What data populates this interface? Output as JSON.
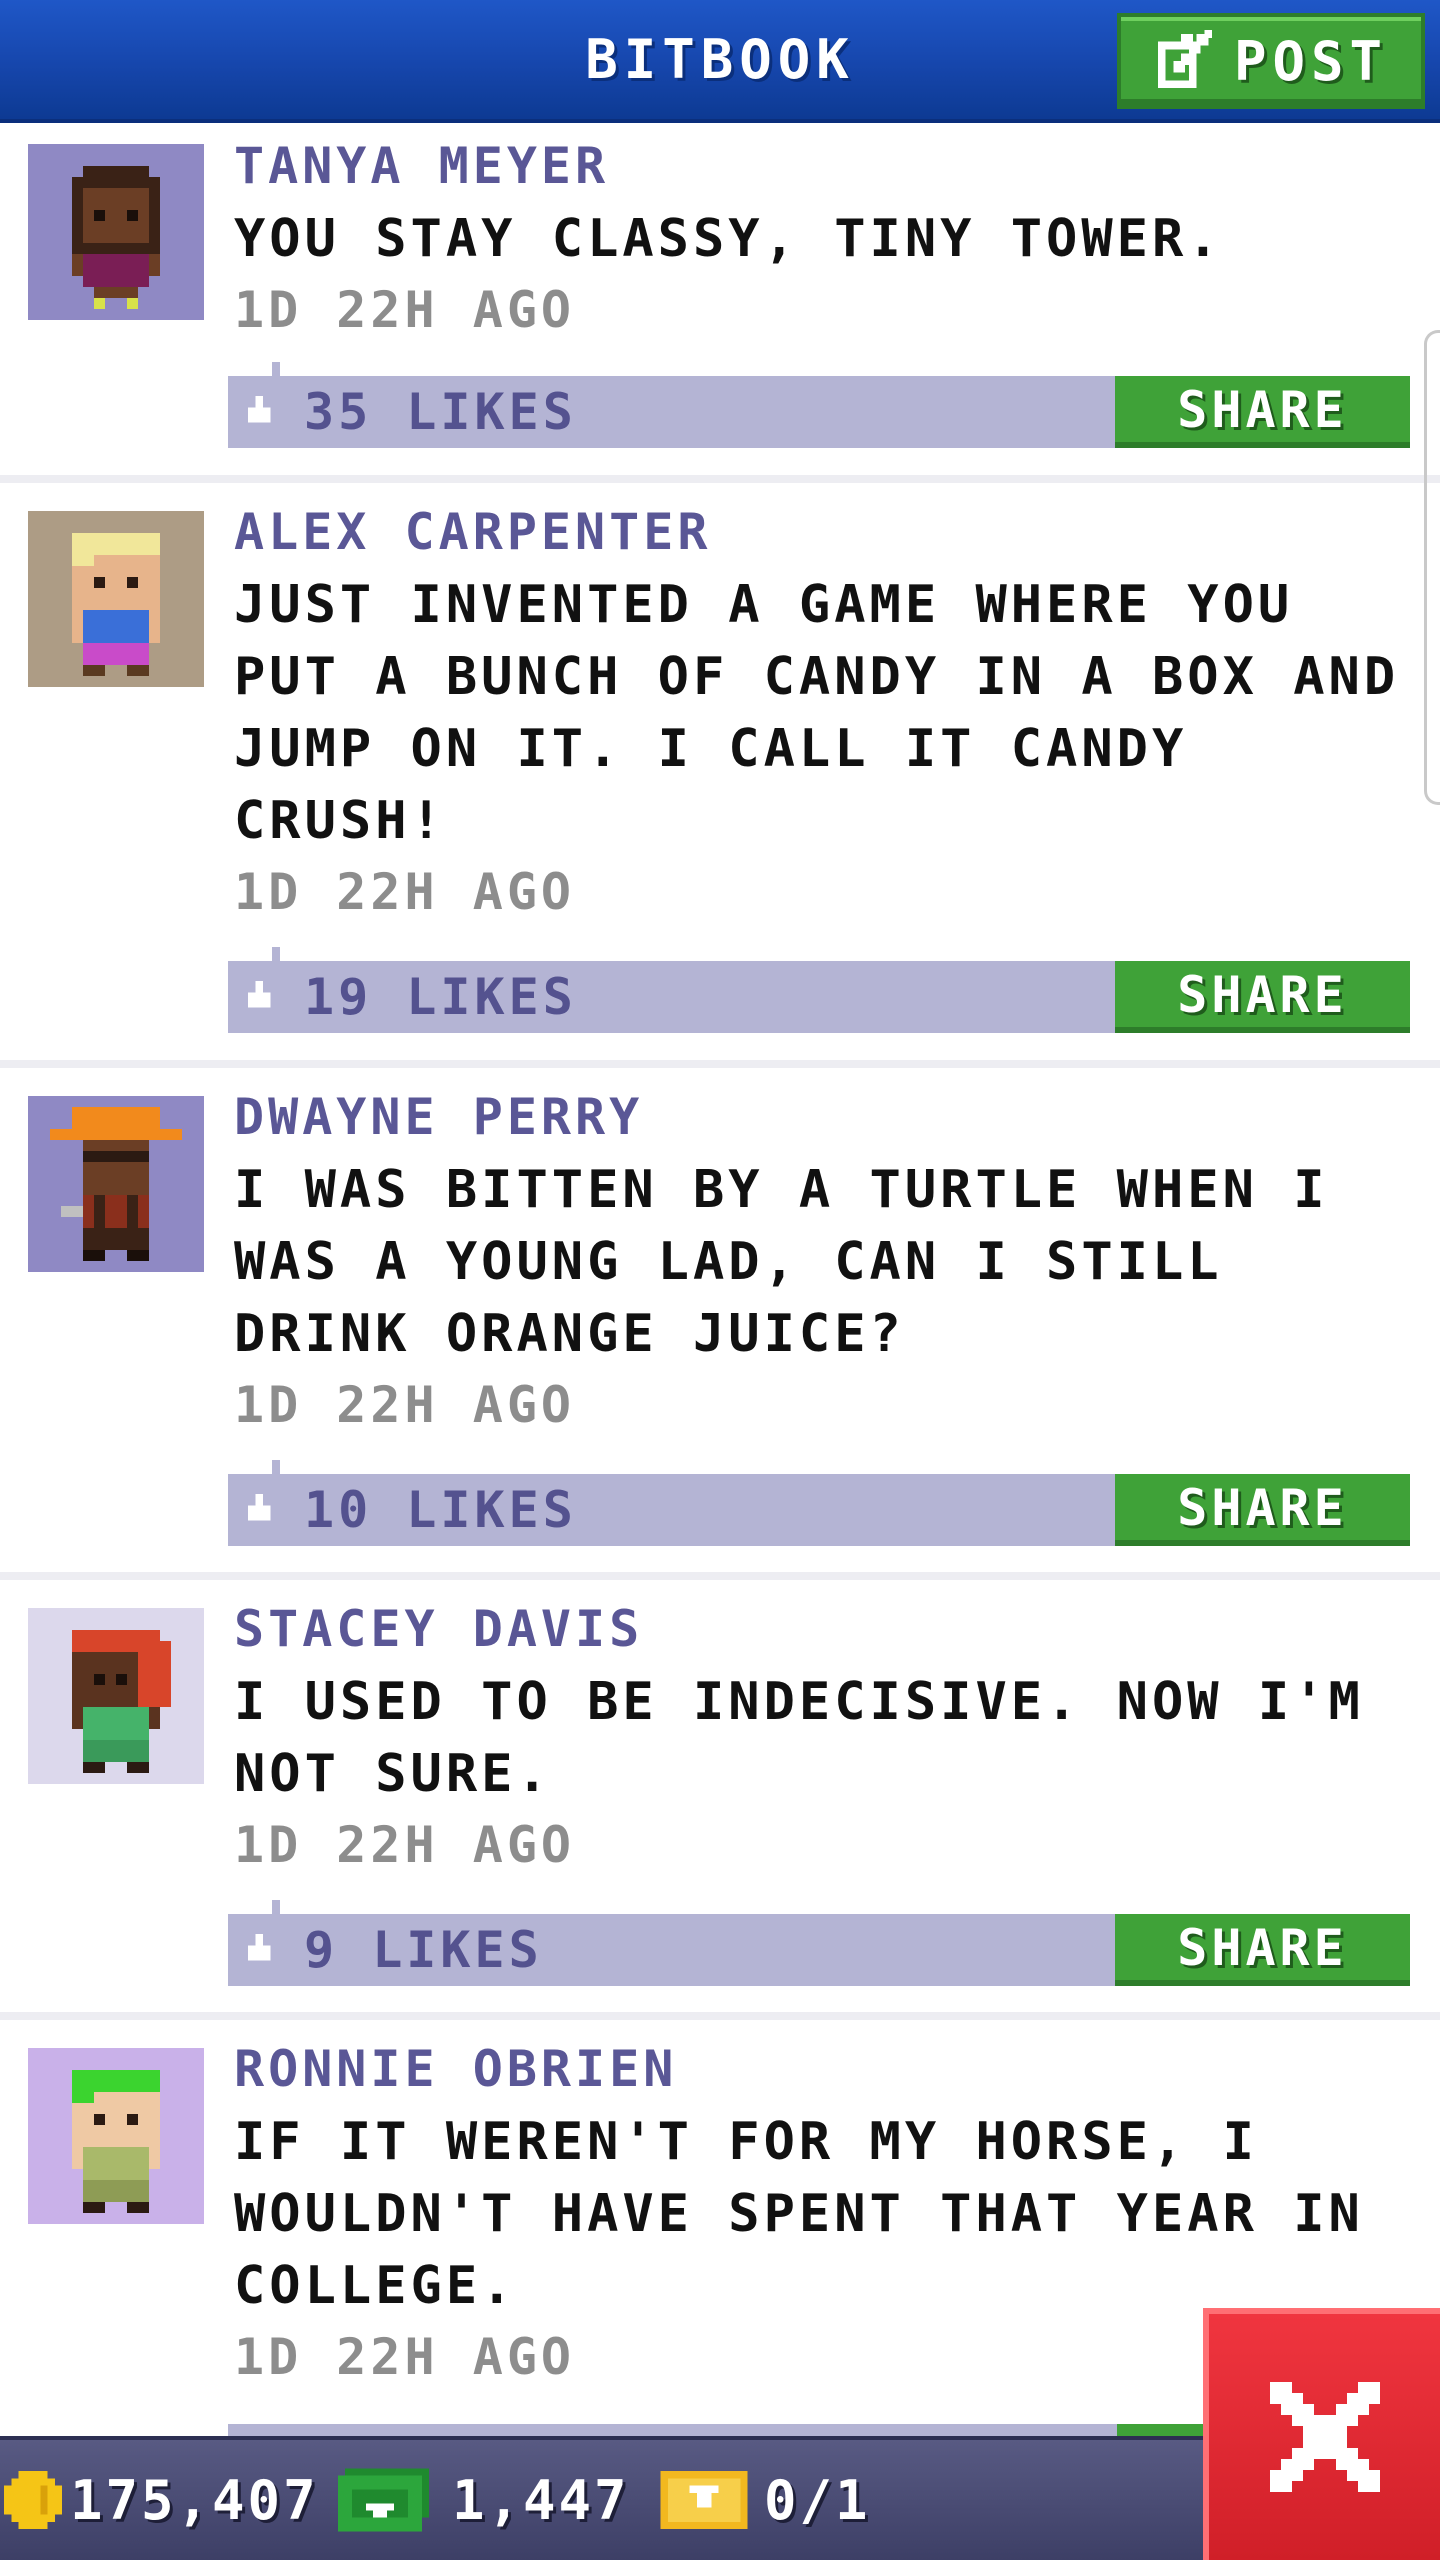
{
  "header": {
    "title": "BITBOOK",
    "post_label": "POST",
    "post_icon": "compose-icon"
  },
  "posts": [
    {
      "name": "TANYA MEYER",
      "text": "YOU STAY CLASSY, TINY TOWER.",
      "time": "1D 22H AGO",
      "likes": "35 LIKES",
      "share": "SHARE",
      "avatar_bg": "#8f89c4"
    },
    {
      "name": "ALEX CARPENTER",
      "text": "JUST INVENTED A GAME WHERE YOU PUT A BUNCH OF CANDY IN A BOX AND JUMP ON IT. I CALL IT CANDY CRUSH!",
      "time": "1D 22H AGO",
      "likes": "19 LIKES",
      "share": "SHARE",
      "avatar_bg": "#ad9c85"
    },
    {
      "name": "DWAYNE PERRY",
      "text": "I WAS BITTEN BY A TURTLE WHEN I WAS A YOUNG LAD, CAN I STILL DRINK ORANGE JUICE?",
      "time": "1D 22H AGO",
      "likes": "10 LIKES",
      "share": "SHARE",
      "avatar_bg": "#8f89c4"
    },
    {
      "name": "STACEY DAVIS",
      "text": "I USED TO BE INDECISIVE. NOW I'M NOT SURE.",
      "time": "1D 22H AGO",
      "likes": "9 LIKES",
      "share": "SHARE",
      "avatar_bg": "#dcd8ec"
    },
    {
      "name": "RONNIE OBRIEN",
      "text": "IF IT WEREN'T FOR MY HORSE, I WOULDN'T HAVE SPENT THAT YEAR IN COLLEGE.",
      "time": "1D 22H AGO",
      "avatar_bg": "#c9b1e9"
    }
  ],
  "status": {
    "coins": "175,407",
    "bux": "1,447",
    "tickets": "0/1"
  },
  "colors": {
    "header_blue": "#1646ac",
    "accent_green": "#3fa238",
    "like_bar": "#b4b4d4",
    "name_purple": "#5a5796",
    "close_red": "#e0262f"
  }
}
